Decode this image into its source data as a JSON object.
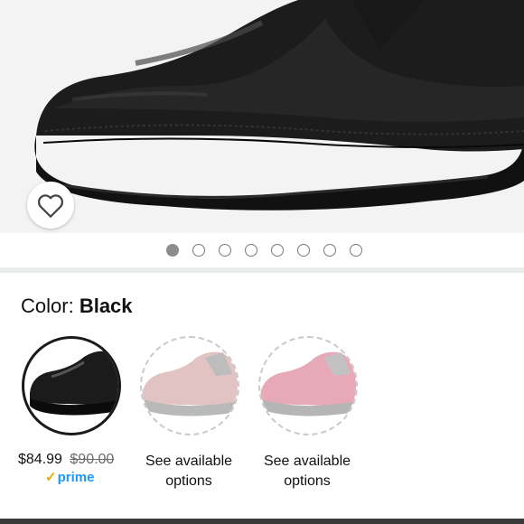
{
  "color_selector": {
    "label": "Color:",
    "selected_value": "Black",
    "swatches": [
      {
        "name": "Black",
        "price": "$84.99",
        "list_price": "$90.00",
        "badge": "prime",
        "badge_check": "✓"
      },
      {
        "name": "Pink",
        "availability": "See available options"
      },
      {
        "name": "Rose",
        "availability": "See available options"
      }
    ]
  },
  "gallery": {
    "image_count": 8,
    "active_index": 0
  },
  "colors": {
    "prime_blue": "#1a98ff",
    "prime_check": "#f0a800",
    "background": "#f3f3f3"
  },
  "icons": {
    "wishlist": "heart-outline-icon"
  }
}
